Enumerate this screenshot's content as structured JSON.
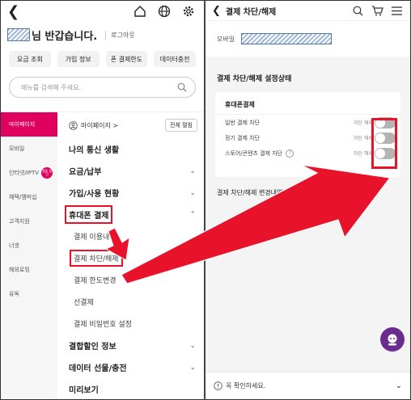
{
  "left": {
    "greeting": "님 반갑습니다.",
    "logout": "로그아웃",
    "quick_buttons": [
      "요금 조회",
      "가입 정보",
      "폰 결제한도",
      "데이터충전"
    ],
    "search_placeholder": "메뉴를 검색해 주세요.",
    "sidenav": [
      {
        "label": "마이페이지"
      },
      {
        "label": "모바일"
      },
      {
        "label": "인터넷/IPTV",
        "badge": "결합 할인"
      },
      {
        "label": "혜택/멤버십"
      },
      {
        "label": "고객지원"
      },
      {
        "label": "너겟"
      },
      {
        "label": "해외로밍"
      },
      {
        "label": "유독"
      }
    ],
    "mypage": "마이페이지 >",
    "edit_all": "전체 펼침",
    "categories": {
      "c1": "나의 통신 생활",
      "c2": "요금/납부",
      "c3": "가입/사용 현황",
      "c4": "휴대폰 결제",
      "c5": "결합할인 정보",
      "c6": "데이터 선물/충전",
      "c7": "미리보기"
    },
    "subitems": [
      "결제 이용내역",
      "결제 차단/해제",
      "결제 한도변경",
      "선결제",
      "결제 비밀번호 설정"
    ]
  },
  "right": {
    "header_title": "결제 차단/해제",
    "mobile_label": "모바일",
    "section_title": "결제 차단/해제 설정상태",
    "card_title": "휴대폰결제",
    "toggles": [
      {
        "label": "일반 결제 차단",
        "state": "차단 해제"
      },
      {
        "label": "정기 결제 차단",
        "state": "차단 해제"
      },
      {
        "label": "스토어/콘텐츠 결제 차단",
        "state": "차단 해제"
      }
    ],
    "history_link": "결제 차단/해제 변경내역 확인하기 >",
    "notice": "꼭 확인하세요."
  },
  "colors": {
    "accent": "#e0005f",
    "annotation": "#e8132b",
    "toggle_off": "#b4b4b4"
  },
  "icons": [
    "back-arrow-icon",
    "home-icon",
    "globe-icon",
    "settings-gear-icon",
    "search-icon",
    "cart-icon",
    "hamburger-menu-icon",
    "chevron-down-icon",
    "chevron-up-icon",
    "question-icon",
    "info-icon",
    "chat-bot-icon"
  ]
}
